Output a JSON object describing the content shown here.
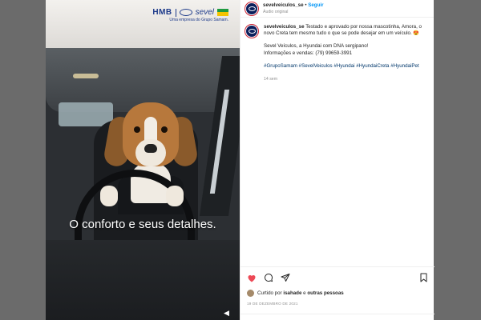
{
  "media": {
    "caption_overlay": "O conforto e seus detalhes.",
    "brand": {
      "hmb": "HMB",
      "sevel": "sevel",
      "tagline": "Uma empresa do Grupo Samam."
    }
  },
  "header": {
    "username": "sevelveiculos_se",
    "separator": "•",
    "follow_label": "Seguir",
    "audio_label": "Áudio original"
  },
  "caption": {
    "username": "sevelveiculos_se",
    "text": "Testado e aprovado por nossa mascotinha, Amora, o novo Creta tem mesmo tudo o que se pode desejar em um veículo. 😍",
    "line2": "Sevel Veículos, a Hyundai com DNA sergipano!",
    "line3": "Informações e vendas: (79) 99659-3991",
    "hashtags": "#GrupoSamam #SevelVeiculos #Hyundai #HyundaiCreta #HyundaiPet",
    "time_ago": "14 sem"
  },
  "actions": {
    "like_icon": "heart-icon",
    "comment_icon": "comment-icon",
    "share_icon": "share-icon",
    "save_icon": "bookmark-icon",
    "liked_prefix": "Curtido por",
    "liked_user": "isahade",
    "liked_suffix": "e",
    "liked_others": "outras pessoas",
    "date": "19 DE DEZEMBRO DE 2021"
  },
  "colors": {
    "like": "#ed4956",
    "follow": "#0095f6",
    "hashtag": "#00376b",
    "backdrop": "#6b6b6b"
  }
}
